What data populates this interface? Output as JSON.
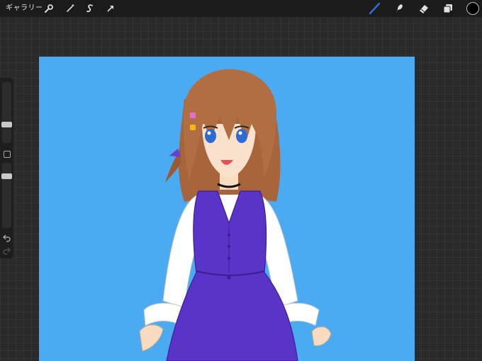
{
  "toolbar": {
    "gallery_label": "ギャラリー",
    "left_tools": [
      "wrench-icon",
      "magic-wand-icon",
      "selection-s-icon",
      "transform-arrow-icon"
    ],
    "right_tools": [
      "brush-icon",
      "smudge-icon",
      "eraser-icon",
      "layers-icon",
      "color-swatch"
    ],
    "active_tool": "brush",
    "active_color": "#2f6fd6",
    "current_color": "#000000"
  },
  "sidebar": {
    "brush_size_level": 0.28,
    "opacity_level": 0.82
  },
  "canvas": {
    "background_color": "#4aabf2",
    "subject": "illustration"
  }
}
